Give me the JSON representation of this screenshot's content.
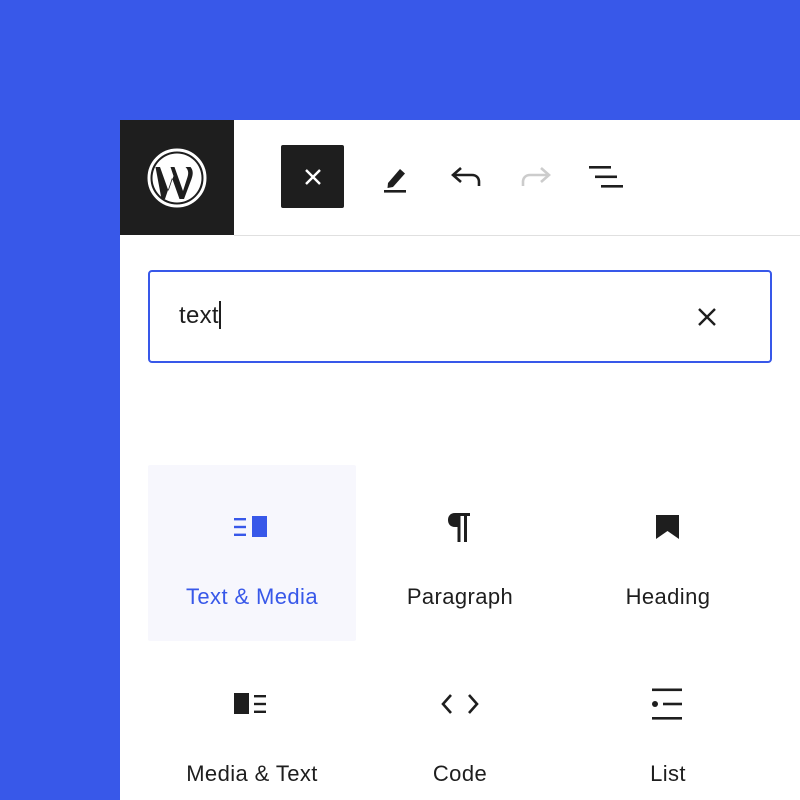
{
  "colors": {
    "background": "#3858e9",
    "accent": "#3858e9",
    "dark": "#1e1e1e",
    "disabled": "#cccccc",
    "selected_tile": "#f7f7fd"
  },
  "toolbar": {
    "logo_icon": "wordpress-logo-icon",
    "buttons": [
      {
        "icon": "close-icon",
        "active": true
      },
      {
        "icon": "pen-icon",
        "active": false
      },
      {
        "icon": "undo-icon",
        "active": false
      },
      {
        "icon": "redo-icon",
        "disabled": true
      },
      {
        "icon": "document-outline-icon",
        "active": false
      }
    ]
  },
  "search": {
    "value": "text",
    "clear_icon": "close-icon"
  },
  "blocks": [
    {
      "label": "Text & Media",
      "icon": "text-media-icon",
      "selected": true
    },
    {
      "label": "Paragraph",
      "icon": "paragraph-icon",
      "selected": false
    },
    {
      "label": "Heading",
      "icon": "heading-bookmark-icon",
      "selected": false
    },
    {
      "label": "Media & Text",
      "icon": "media-text-icon",
      "selected": false
    },
    {
      "label": "Code",
      "icon": "code-icon",
      "selected": false
    },
    {
      "label": "List",
      "icon": "list-icon",
      "selected": false
    }
  ]
}
